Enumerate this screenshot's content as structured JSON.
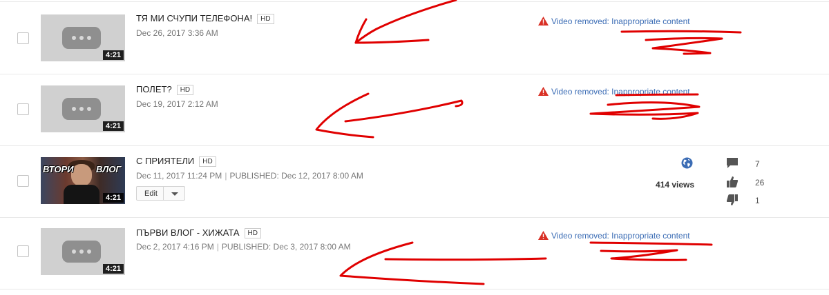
{
  "videos": [
    {
      "title": "ТЯ МИ СЧУПИ ТЕЛЕФОНА!",
      "hd": "HD",
      "date": "Dec 26, 2017 3:36 AM",
      "duration": "4:21",
      "status": "Video removed: Inappropriate content"
    },
    {
      "title": "ПОЛЕТ?",
      "hd": "HD",
      "date": "Dec 19, 2017 2:12 AM",
      "duration": "4:21",
      "status": "Video removed: Inappropriate content"
    },
    {
      "title": "С ПРИЯТЕЛИ",
      "hd": "HD",
      "date": "Dec 11, 2017 11:24 PM",
      "published": "PUBLISHED: Dec 12, 2017 8:00 AM",
      "duration": "4:21",
      "thumb_text_left": "ВТОРИ",
      "thumb_text_right": "ВЛОГ",
      "edit_label": "Edit",
      "visibility_icon": "globe-icon",
      "views": "414 views",
      "comments": "7",
      "likes": "26",
      "dislikes": "1"
    },
    {
      "title": "ПЪРВИ ВЛОГ - ХИЖАТА",
      "hd": "HD",
      "date": "Dec 2, 2017 4:16 PM",
      "published": "PUBLISHED: Dec 3, 2017 8:00 AM",
      "duration": "4:21",
      "status": "Video removed: Inappropriate content"
    }
  ],
  "colors": {
    "link": "#3c6db5",
    "warning": "#d93025",
    "annotation": "#e00000"
  }
}
